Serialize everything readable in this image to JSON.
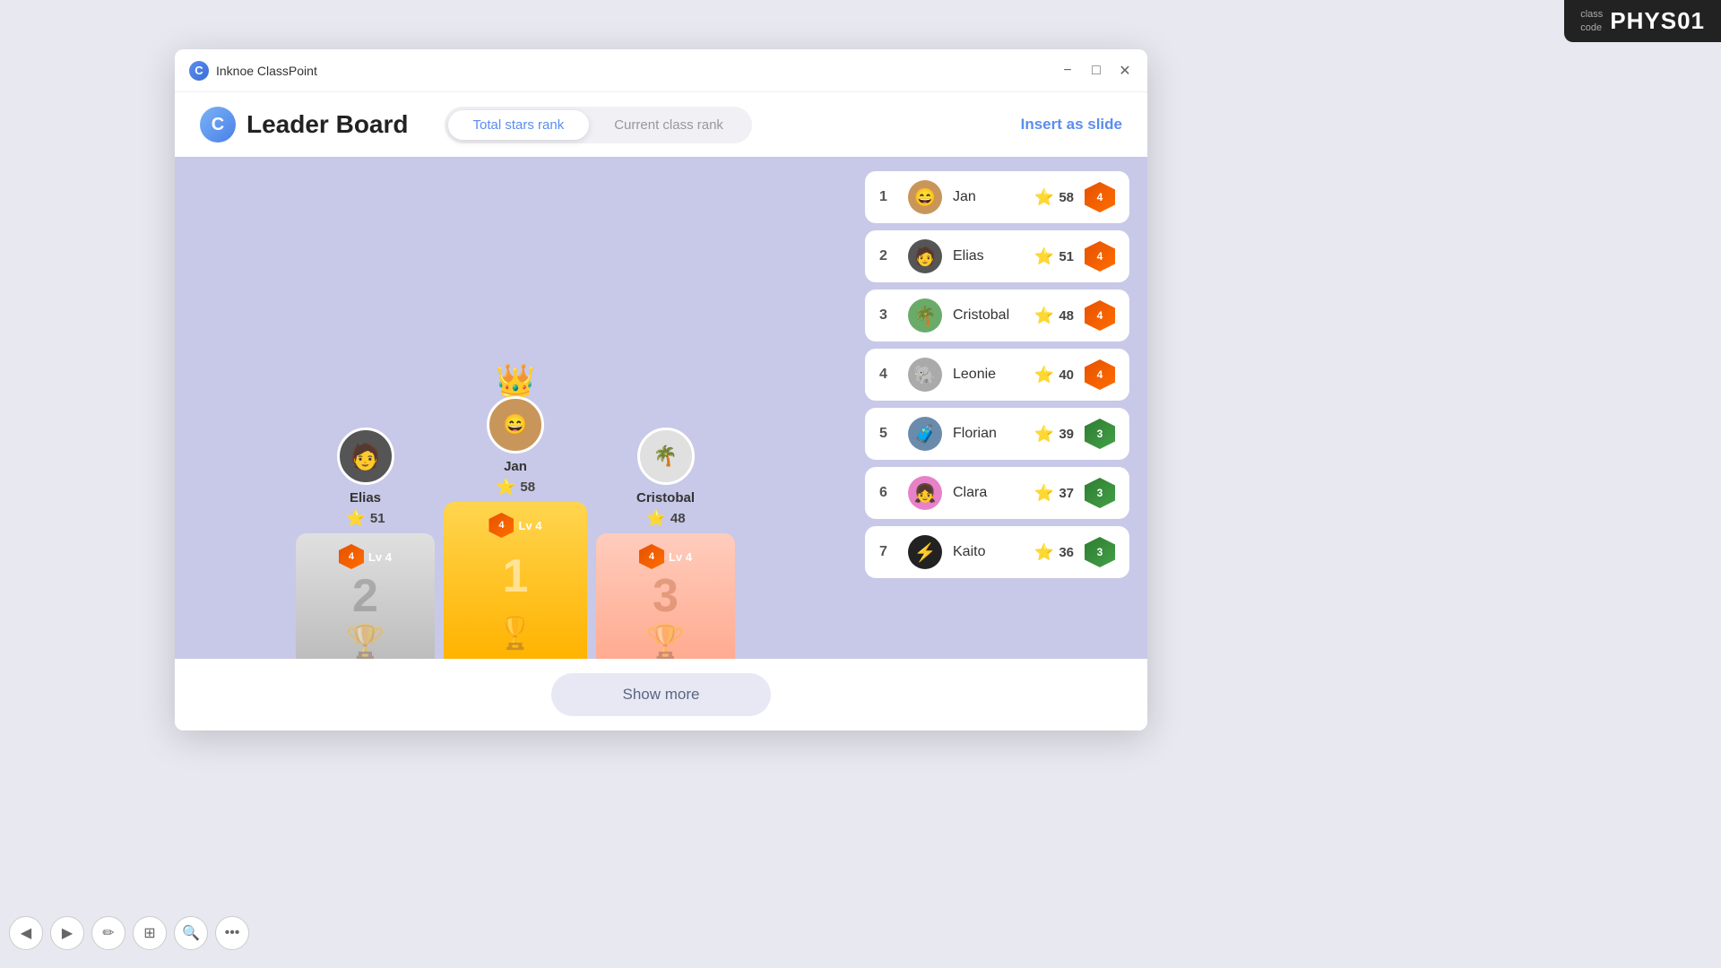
{
  "classcode": {
    "label": "class\ncode",
    "code": "PHYS01"
  },
  "titlebar": {
    "app_name": "Inknoe ClassPoint",
    "minimize_label": "−",
    "maximize_label": "□",
    "close_label": "✕"
  },
  "header": {
    "title": "Leader Board",
    "tab_total_stars": "Total stars rank",
    "tab_current_class": "Current class rank",
    "insert_slide_btn": "Insert as slide"
  },
  "podium": {
    "first": {
      "name": "Jan",
      "stars": 58,
      "level": 4,
      "rank": 1,
      "avatar_emoji": "😄"
    },
    "second": {
      "name": "Elias",
      "stars": 51,
      "level": 4,
      "rank": 2,
      "avatar_emoji": "🧑"
    },
    "third": {
      "name": "Cristobal",
      "stars": 48,
      "level": 4,
      "rank": 3,
      "avatar_emoji": "🌴"
    }
  },
  "leaderboard": {
    "rows": [
      {
        "rank": 1,
        "name": "Jan",
        "stars": 58,
        "level": 4,
        "level_color": "orange",
        "avatar_emoji": "😄"
      },
      {
        "rank": 2,
        "name": "Elias",
        "stars": 51,
        "level": 4,
        "level_color": "orange",
        "avatar_emoji": "🧑"
      },
      {
        "rank": 3,
        "name": "Cristobal",
        "stars": 48,
        "level": 4,
        "level_color": "orange",
        "avatar_emoji": "🌴"
      },
      {
        "rank": 4,
        "name": "Leonie",
        "stars": 40,
        "level": 4,
        "level_color": "orange",
        "avatar_emoji": "🐘"
      },
      {
        "rank": 5,
        "name": "Florian",
        "stars": 39,
        "level": 3,
        "level_color": "green",
        "avatar_emoji": "🧳"
      },
      {
        "rank": 6,
        "name": "Clara",
        "stars": 37,
        "level": 3,
        "level_color": "green",
        "avatar_emoji": "👧"
      },
      {
        "rank": 7,
        "name": "Kaito",
        "stars": 36,
        "level": 3,
        "level_color": "green",
        "avatar_emoji": "⚡"
      }
    ]
  },
  "footer": {
    "show_more": "Show more"
  },
  "toolbar": {
    "btns": [
      "◀",
      "▶",
      "✏",
      "⊞",
      "🔍",
      "•••"
    ]
  }
}
